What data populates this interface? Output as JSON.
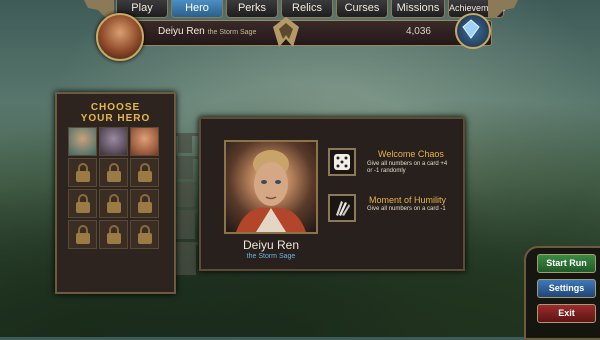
{
  "nav": {
    "tabs": [
      {
        "label": "Play",
        "active": false
      },
      {
        "label": "Hero",
        "active": true
      },
      {
        "label": "Perks",
        "active": false
      },
      {
        "label": "Relics",
        "active": false
      },
      {
        "label": "Curses",
        "active": false
      },
      {
        "label": "Missions",
        "active": false
      },
      {
        "label": "Achievements",
        "active": false
      }
    ]
  },
  "player": {
    "hero_name": "Deiyu Ren",
    "hero_title": "the Storm Sage",
    "score": "4,036"
  },
  "choose_panel": {
    "heading_line1": "CHOOSE",
    "heading_line2": "YOUR HERO",
    "slots": [
      {
        "state": "unlocked",
        "icon": "hero-portrait-icon"
      },
      {
        "state": "unlocked",
        "icon": "hero-portrait-icon"
      },
      {
        "state": "unlocked",
        "icon": "hero-portrait-icon"
      },
      {
        "state": "locked",
        "icon": "padlock-icon"
      },
      {
        "state": "locked",
        "icon": "padlock-icon"
      },
      {
        "state": "locked",
        "icon": "padlock-icon"
      },
      {
        "state": "locked",
        "icon": "padlock-icon"
      },
      {
        "state": "locked",
        "icon": "padlock-icon"
      },
      {
        "state": "locked",
        "icon": "padlock-icon"
      },
      {
        "state": "locked",
        "icon": "padlock-icon"
      },
      {
        "state": "locked",
        "icon": "padlock-icon"
      },
      {
        "state": "locked",
        "icon": "padlock-icon"
      }
    ]
  },
  "detail": {
    "name": "Deiyu Ren",
    "title": "the Storm Sage",
    "abilities": [
      {
        "name": "Welcome Chaos",
        "desc_line1": "Give all numbers on a card +4",
        "desc_line2": "or -1 randomly",
        "icon": "dice-icon"
      },
      {
        "name": "Moment of Humility",
        "desc_line1": "Give all numbers on a card -1",
        "desc_line2": "",
        "icon": "cards-icon"
      }
    ]
  },
  "buttons": {
    "start": "Start Run",
    "settings": "Settings",
    "exit": "Exit"
  },
  "colors": {
    "accent_gold": "#e7b34b",
    "active_tab": "#4c8fc4",
    "hero_title_blue": "#6fb2e8",
    "start_green": "#2f7a38",
    "settings_blue": "#2f5f98",
    "exit_red": "#7e2020"
  }
}
